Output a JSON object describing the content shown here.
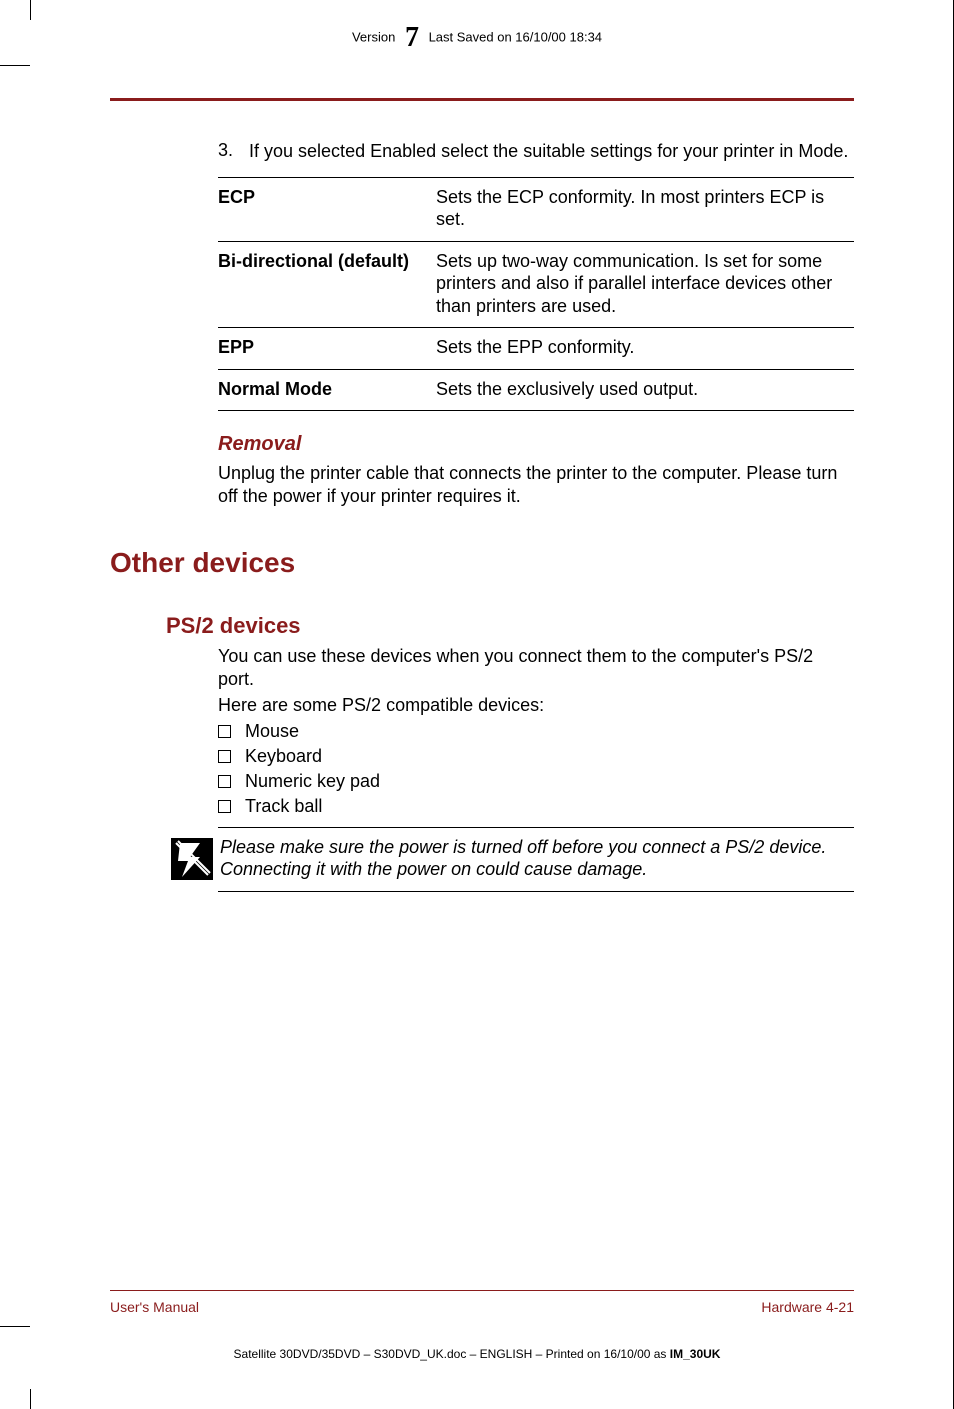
{
  "header": {
    "version_prefix": "Version",
    "version_num": "7",
    "saved_text": "Last Saved on 16/10/00 18:34"
  },
  "step": {
    "number": "3.",
    "text": "If you selected Enabled select the suitable settings for your printer in Mode."
  },
  "modes": [
    {
      "label": "ECP",
      "desc": "Sets the ECP conformity. In most printers ECP is set."
    },
    {
      "label": "Bi-directional (default)",
      "desc": "Sets up two-way communication. Is set for some printers and also if parallel interface devices other than printers are used."
    },
    {
      "label": "EPP",
      "desc": "Sets the EPP conformity."
    },
    {
      "label": "Normal Mode",
      "desc": "Sets the exclusively used output."
    }
  ],
  "removal": {
    "heading": "Removal",
    "text": "Unplug the printer cable that connects the printer to the computer. Please turn off the power if your printer requires it."
  },
  "other_devices": {
    "heading": "Other devices"
  },
  "ps2": {
    "heading": "PS/2 devices",
    "intro": "You can use these devices when you connect them to the computer's PS/2 port.",
    "list_intro": "Here are some PS/2 compatible devices:",
    "items": [
      "Mouse",
      "Keyboard",
      "Numeric key pad",
      "Track ball"
    ],
    "note": "Please make sure the power is turned off before you connect a PS/2 device. Connecting it with the power on could cause damage."
  },
  "footer": {
    "left": "User's Manual",
    "right": "Hardware  4-21",
    "print": "Satellite 30DVD/35DVD  – S30DVD_UK.doc – ENGLISH – Printed on 16/10/00 as ",
    "print_bold": "IM_30UK"
  }
}
